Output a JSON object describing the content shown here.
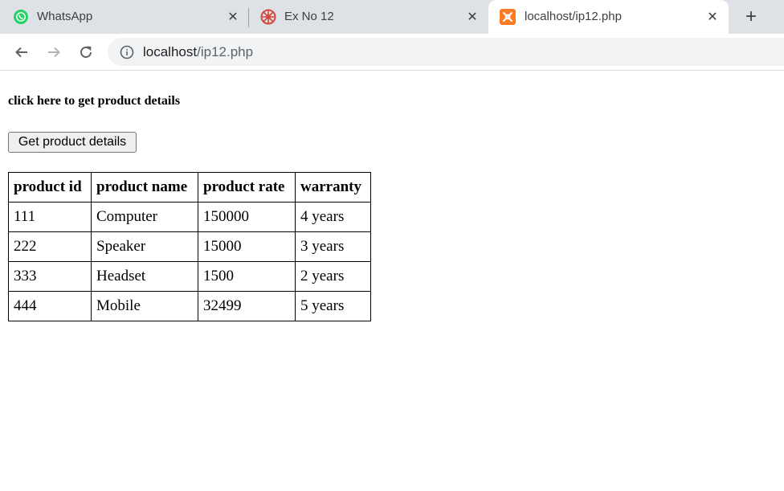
{
  "browser": {
    "tabs": [
      {
        "title": "WhatsApp",
        "favicon": "whatsapp-icon",
        "active": false
      },
      {
        "title": "Ex No 12",
        "favicon": "moodle-icon",
        "active": false
      },
      {
        "title": "localhost/ip12.php",
        "favicon": "xampp-icon",
        "active": true
      }
    ],
    "address": {
      "host": "localhost",
      "path": "/ip12.php"
    }
  },
  "page": {
    "prompt": "click here to get product details",
    "button_label": "Get product details",
    "table": {
      "headers": [
        "product id",
        "product name",
        "product rate",
        "warranty"
      ],
      "rows": [
        [
          "111",
          "Computer",
          "150000",
          "4 years"
        ],
        [
          "222",
          "Speaker",
          "15000",
          "3 years"
        ],
        [
          "333",
          "Headset",
          "1500",
          "2 years"
        ],
        [
          "444",
          "Mobile",
          "32499",
          "5 years"
        ]
      ]
    }
  },
  "colors": {
    "tabstrip": "#dee1e6",
    "omnibox": "#f1f3f4",
    "whatsapp": "#25d366",
    "xampp": "#fb7a24",
    "moodle": "#d4493a"
  }
}
